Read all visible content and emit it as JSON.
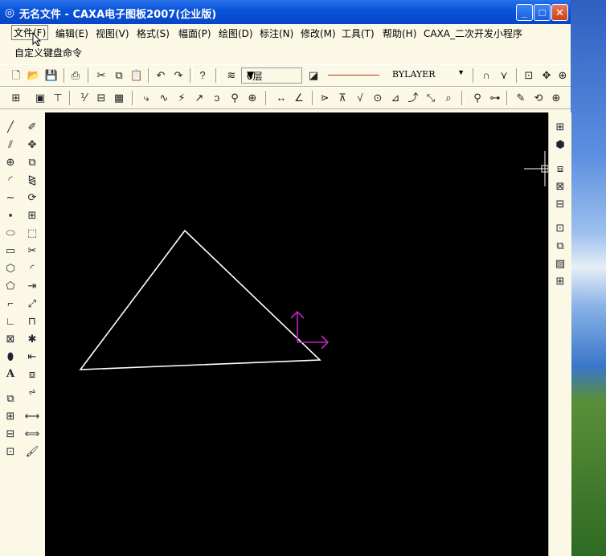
{
  "window": {
    "title": "无名文件 - CAXA电子图板2007(企业版)",
    "minimize_label": "_",
    "maximize_label": "□",
    "close_label": "✕"
  },
  "menu": {
    "items": [
      "文件(F)",
      "编辑(E)",
      "视图(V)",
      "格式(S)",
      "幅面(P)",
      "绘图(D)",
      "标注(N)",
      "修改(M)",
      "工具(T)",
      "帮助(H)",
      "CAXA_二次开发小程序"
    ],
    "second_row": "自定义键盘命令"
  },
  "toolbar": {
    "layer_value": "0层",
    "linetype_value": "BYLAYER"
  },
  "colors": {
    "title_bar": "#0a55dc",
    "canvas_bg": "#000000",
    "triangle": "#ffffff",
    "ucs": "#c026c0",
    "linetype_red": "#c03020"
  },
  "drawing": {
    "shape": "triangle",
    "ucs_icon": "coordinate-axes-icon"
  }
}
